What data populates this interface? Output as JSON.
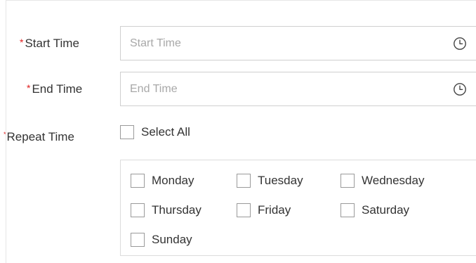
{
  "form": {
    "start_time": {
      "required_mark": "*",
      "label": "Start Time",
      "placeholder": "Start Time",
      "value": "",
      "icon": "clock-icon"
    },
    "end_time": {
      "required_mark": "*",
      "label": "End Time",
      "placeholder": "End Time",
      "value": "",
      "icon": "clock-icon"
    },
    "repeat_time": {
      "required_mark": "*",
      "label": "Repeat Time",
      "select_all_label": "Select All",
      "select_all_checked": false,
      "days": [
        {
          "label": "Monday",
          "checked": false
        },
        {
          "label": "Tuesday",
          "checked": false
        },
        {
          "label": "Wednesday",
          "checked": false
        },
        {
          "label": "Thursday",
          "checked": false
        },
        {
          "label": "Friday",
          "checked": false
        },
        {
          "label": "Saturday",
          "checked": false
        },
        {
          "label": "Sunday",
          "checked": false
        }
      ]
    }
  },
  "colors": {
    "required": "#e02020",
    "text": "#333333",
    "placeholder": "#a8a8a8",
    "border": "#cfcfcf"
  }
}
